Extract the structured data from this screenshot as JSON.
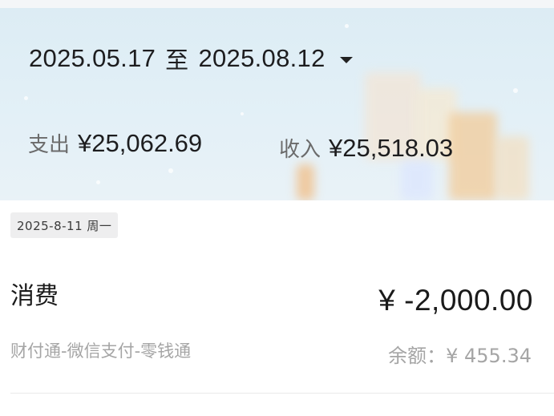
{
  "period": {
    "start": "2025.05.17",
    "separator": "至",
    "end": "2025.08.12"
  },
  "summary": {
    "expense_label": "支出",
    "expense_value": "¥25,062.69",
    "income_label": "收入",
    "income_value": "¥25,518.03"
  },
  "group": {
    "date": "2025-8-11 周一"
  },
  "record": {
    "title": "消费",
    "amount": "¥ -2,000.00",
    "source": "财付通-微信支付-零钱通",
    "balance": "余额：¥ 455.34"
  },
  "colors": {
    "header_bg": "#dcecf4",
    "text_primary": "#1d1d1f",
    "text_muted": "#a5a5a5"
  },
  "icons": {
    "period_dropdown": "caret-down-icon"
  }
}
